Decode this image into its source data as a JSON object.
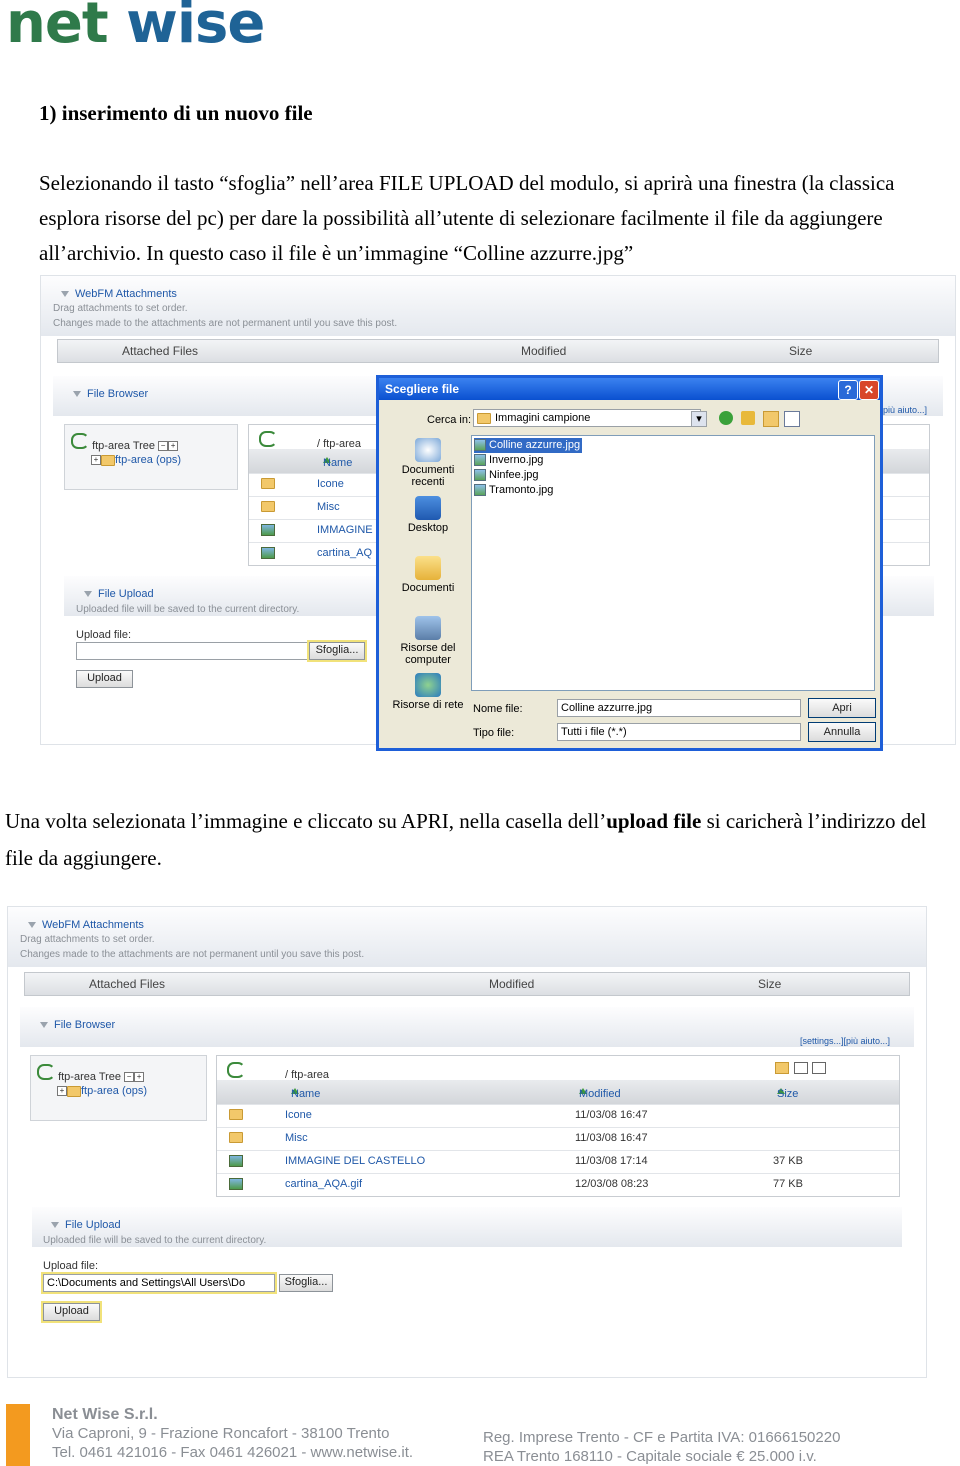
{
  "logo": {
    "part1": "net",
    "part2": "wise"
  },
  "heading": "1)   inserimento di un nuovo file",
  "para1": "Selezionando il tasto “sfoglia” nell’area FILE UPLOAD del modulo, si aprirà una finestra (la classica esplora risorse del  pc) per dare la possibilità all’utente di selezionare facilmente il file da aggiungere all’archivio. In questo caso il file è un’immagine “Colline azzurre.jpg”",
  "para2": {
    "before": "Una volta selezionata l’immagine e cliccato su APRI, nella casella dell’",
    "bold": "upload file",
    "after": " si caricherà l’indirizzo del file da aggiungere."
  },
  "webfm": {
    "title": "WebFM Attachments",
    "desc1": "Drag attachments to set order.",
    "desc2": "Changes made to the attachments are not permanent until you save this post.",
    "col_files": "Attached Files",
    "col_modified": "Modified",
    "col_size": "Size",
    "file_browser": "File Browser",
    "links": "[settings...][più aiuto...]",
    "links_partial": "più aiuto...]",
    "tree_title": "ftp-area Tree",
    "tree_item": "ftp-area (ops)",
    "path": "/  ftp-area",
    "th_name": "Name",
    "th_modified": "Modified",
    "th_size": "Size",
    "rows": [
      {
        "name": "Icone",
        "modified": "11/03/08 16:47",
        "size": ""
      },
      {
        "name": "Misc",
        "modified": "11/03/08 16:47",
        "size": ""
      },
      {
        "name": "IMMAGINE DEL CASTELLO",
        "modified": "11/03/08 17:14",
        "size": "37 KB"
      },
      {
        "name": "cartina_AQA.gif",
        "modified": "12/03/08 08:23",
        "size": "77 KB"
      }
    ],
    "row_partial_3": "IMMAGINE D",
    "row_partial_4": "cartina_AQ",
    "upload_title": "File Upload",
    "upload_desc": "Uploaded file will be saved to the current directory.",
    "upload_label": "Upload file:",
    "browse_btn": "Sfoglia...",
    "upload_btn": "Upload",
    "upload_value": "C:\\Documents and Settings\\All Users\\Do"
  },
  "dialog": {
    "title": "Scegliere file",
    "help": "?",
    "close": "✕",
    "look_in_label": "Cerca in:",
    "look_in_value": "Immagini campione",
    "places": [
      "Documenti recenti",
      "Desktop",
      "Documenti",
      "Risorse del computer",
      "Risorse di rete"
    ],
    "files": [
      "Colline azzurre.jpg",
      "Inverno.jpg",
      "Ninfee.jpg",
      "Tramonto.jpg"
    ],
    "filename_label": "Nome file:",
    "filename_value": "Colline azzurre.jpg",
    "filetype_label": "Tipo file:",
    "filetype_value": "Tutti i file (*.*)",
    "open_btn": "Apri",
    "cancel_btn": "Annulla"
  },
  "footer": {
    "company": "Net Wise S.r.l.",
    "address": "Via Caproni, 9 - Frazione Roncafort - 38100 Trento",
    "contacts": "Tel. 0461 421016 - Fax 0461 426021 -  www.netwise.it.",
    "reg": "Reg. Imprese Trento - CF e Partita IVA: 01666150220",
    "rea": "REA Trento 168110 - Capitale sociale € 25.000 i.v."
  },
  "colors": {
    "logo_green": "#2f7a4a",
    "logo_blue": "#1f6396",
    "link_blue": "#1f58a8",
    "xp_blue": "#0a50d0",
    "footer_orange": "#f39a1f"
  }
}
